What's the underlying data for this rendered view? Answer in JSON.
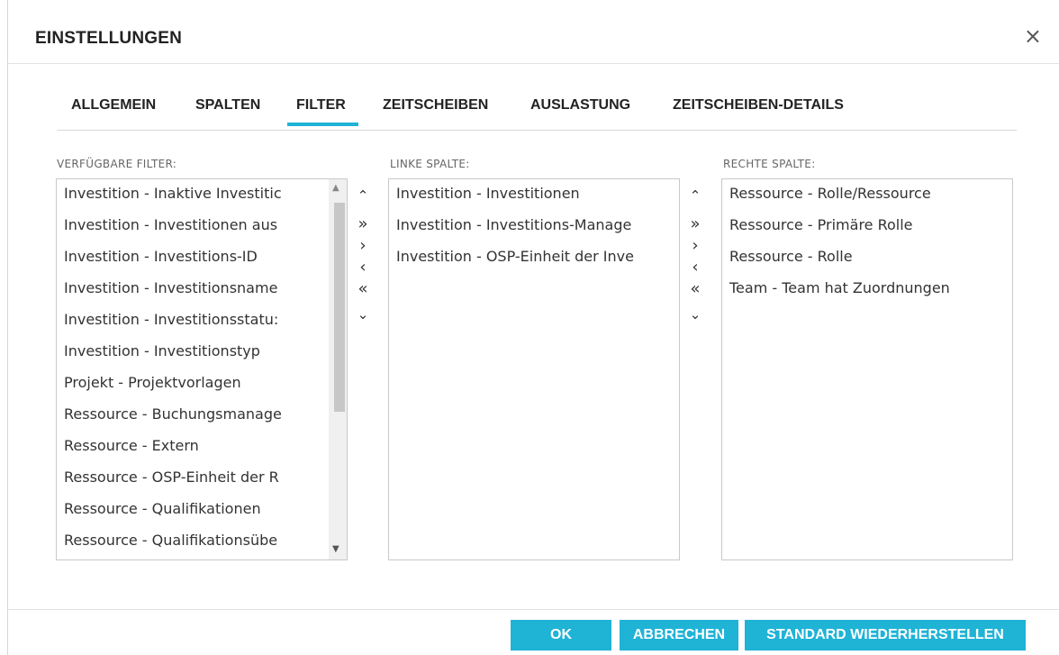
{
  "dialog": {
    "title": "EINSTELLUNGEN",
    "close_glyph": "×"
  },
  "tabs": [
    {
      "label": "ALLGEMEIN",
      "active": false
    },
    {
      "label": "SPALTEN",
      "active": false
    },
    {
      "label": "FILTER",
      "active": true
    },
    {
      "label": "ZEITSCHEIBEN",
      "active": false
    },
    {
      "label": "AUSLASTUNG",
      "active": false
    },
    {
      "label": "ZEITSCHEIBEN-DETAILS",
      "active": false
    }
  ],
  "available": {
    "label": "VERFÜGBARE FILTER:",
    "items": [
      "Investition - Inaktive Investitic",
      "Investition - Investitionen aus",
      "Investition - Investitions-ID",
      "Investition - Investitionsname",
      "Investition - Investitionsstatu:",
      "Investition - Investitionstyp",
      "Projekt - Projektvorlagen",
      "Ressource - Buchungsmanage",
      "Ressource - Extern",
      "Ressource - OSP-Einheit der R",
      "Ressource - Qualifikationen",
      "Ressource - Qualifikationsübe"
    ]
  },
  "left": {
    "label": "LINKE SPALTE:",
    "items": [
      "Investition - Investitionen",
      "Investition - Investitions-Manage",
      "Investition - OSP-Einheit der Inve"
    ]
  },
  "right": {
    "label": "RECHTE SPALTE:",
    "items": [
      "Ressource - Rolle/Ressource",
      "Ressource - Primäre Rolle",
      "Ressource - Rolle",
      "Team - Team hat Zuordnungen"
    ]
  },
  "move_controls": {
    "up": "⌃",
    "add_all": "»",
    "add": "›",
    "remove": "‹",
    "remove_all": "«",
    "down": "⌄"
  },
  "buttons": {
    "ok": "OK",
    "cancel": "ABBRECHEN",
    "reset": "STANDARD WIEDERHERSTELLEN"
  },
  "colors": {
    "accent": "#1fb3d6"
  }
}
